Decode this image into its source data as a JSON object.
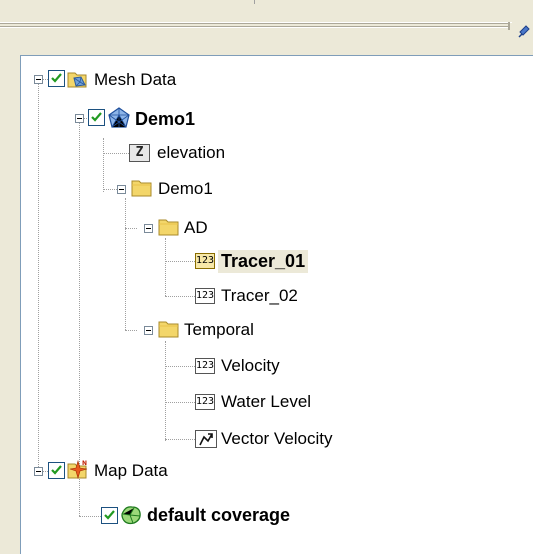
{
  "tree": {
    "mesh_data": {
      "label": "Mesh Data",
      "checked": true
    },
    "demo1_mesh": {
      "label": "Demo1",
      "checked": true
    },
    "elevation": {
      "label": "elevation",
      "icon_text": "Z"
    },
    "demo1_folder": {
      "label": "Demo1"
    },
    "ad_folder": {
      "label": "AD"
    },
    "tracer_01": {
      "label": "Tracer_01",
      "icon_text": "123",
      "selected": true
    },
    "tracer_02": {
      "label": "Tracer_02",
      "icon_text": "123"
    },
    "temporal_folder": {
      "label": "Temporal"
    },
    "velocity": {
      "label": "Velocity",
      "icon_text": "123"
    },
    "water_level": {
      "label": "Water Level",
      "icon_text": "123"
    },
    "vector_velocity": {
      "label": "Vector Velocity"
    },
    "map_data": {
      "label": "Map Data",
      "checked": true
    },
    "default_coverage": {
      "label": "default coverage",
      "checked": true
    }
  },
  "colors": {
    "panel_bg": "#ece9d8",
    "tree_bg": "#ffffff",
    "folder_yellow": "#f3d66a",
    "selection_bg": "#ece9d8",
    "checkbox_border": "#1c5180",
    "check_green": "#219a21"
  }
}
